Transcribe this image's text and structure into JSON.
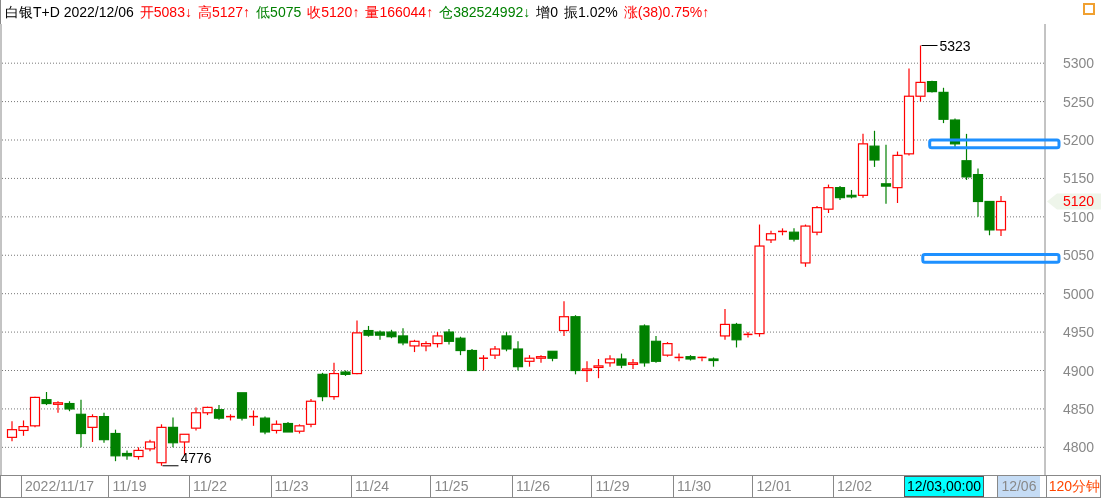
{
  "header": {
    "title": "白银T+D 2022/12/06",
    "quotes": [
      {
        "text": "开5083↓",
        "color": "#ff0000"
      },
      {
        "text": "高5127↑",
        "color": "#ff0000"
      },
      {
        "text": "低5075",
        "color": "#008000"
      },
      {
        "text": "收5120↑",
        "color": "#ff0000"
      },
      {
        "text": "量166044↑",
        "color": "#ff0000"
      },
      {
        "text": "仓382524992↓",
        "color": "#008000"
      },
      {
        "text": "增0",
        "color": "#000000"
      },
      {
        "text": "振1.02%",
        "color": "#000000"
      },
      {
        "text": "涨(38)0.75%↑",
        "color": "#ff0000"
      }
    ]
  },
  "chart_data": {
    "type": "candlestick",
    "ylim": [
      4764,
      5351
    ],
    "yticks": [
      4800,
      4850,
      4900,
      4950,
      5000,
      5050,
      5100,
      5150,
      5200,
      5250,
      5300
    ],
    "grid": true,
    "ohlc": [
      [
        4813,
        4834,
        4808,
        4823
      ],
      [
        4822,
        4835,
        4815,
        4827
      ],
      [
        4828,
        4866,
        4826,
        4865
      ],
      [
        4862,
        4872,
        4855,
        4857
      ],
      [
        4856,
        4860,
        4845,
        4858
      ],
      [
        4857,
        4860,
        4847,
        4850
      ],
      [
        4843,
        4862,
        4800,
        4818
      ],
      [
        4826,
        4843,
        4807,
        4840
      ],
      [
        4840,
        4845,
        4806,
        4810
      ],
      [
        4818,
        4823,
        4782,
        4789
      ],
      [
        4792,
        4796,
        4784,
        4789
      ],
      [
        4788,
        4800,
        4784,
        4796
      ],
      [
        4798,
        4810,
        4795,
        4807
      ],
      [
        4780,
        4830,
        4776,
        4826
      ],
      [
        4826,
        4839,
        4800,
        4806
      ],
      [
        4807,
        4817,
        4790,
        4817
      ],
      [
        4825,
        4852,
        4822,
        4845
      ],
      [
        4845,
        4853,
        4842,
        4852
      ],
      [
        4849,
        4855,
        4836,
        4838
      ],
      [
        4840,
        4843,
        4835,
        4840
      ],
      [
        4871,
        4871,
        4835,
        4838
      ],
      [
        4840,
        4848,
        4828,
        4840
      ],
      [
        4838,
        4840,
        4817,
        4820
      ],
      [
        4822,
        4835,
        4818,
        4830
      ],
      [
        4831,
        4833,
        4820,
        4820
      ],
      [
        4821,
        4830,
        4818,
        4828
      ],
      [
        4830,
        4863,
        4826,
        4860
      ],
      [
        4895,
        4897,
        4860,
        4866
      ],
      [
        4866,
        4910,
        4862,
        4896
      ],
      [
        4898,
        4900,
        4893,
        4895
      ],
      [
        4896,
        4965,
        4895,
        4949
      ],
      [
        4952,
        4958,
        4944,
        4946
      ],
      [
        4950,
        4952,
        4940,
        4946
      ],
      [
        4950,
        4953,
        4942,
        4944
      ],
      [
        4945,
        4955,
        4933,
        4936
      ],
      [
        4932,
        4940,
        4924,
        4938
      ],
      [
        4932,
        4938,
        4925,
        4935
      ],
      [
        4935,
        4950,
        4930,
        4945
      ],
      [
        4950,
        4954,
        4934,
        4938
      ],
      [
        4942,
        4944,
        4920,
        4926
      ],
      [
        4926,
        4928,
        4900,
        4900
      ],
      [
        4915,
        4920,
        4900,
        4916
      ],
      [
        4920,
        4932,
        4915,
        4928
      ],
      [
        4945,
        4950,
        4925,
        4928
      ],
      [
        4928,
        4938,
        4900,
        4905
      ],
      [
        4912,
        4920,
        4905,
        4916
      ],
      [
        4916,
        4920,
        4910,
        4918
      ],
      [
        4925,
        4925,
        4912,
        4916
      ],
      [
        4952,
        4990,
        4945,
        4970
      ],
      [
        4970,
        4972,
        4895,
        4900
      ],
      [
        4900,
        4912,
        4885,
        4902
      ],
      [
        4904,
        4915,
        4890,
        4906
      ],
      [
        4910,
        4920,
        4905,
        4915
      ],
      [
        4915,
        4922,
        4903,
        4907
      ],
      [
        4908,
        4915,
        4902,
        4910
      ],
      [
        4958,
        4960,
        4905,
        4910
      ],
      [
        4938,
        4945,
        4910,
        4912
      ],
      [
        4920,
        4937,
        4918,
        4935
      ],
      [
        4916,
        4922,
        4912,
        4917
      ],
      [
        4918,
        4920,
        4913,
        4915
      ],
      [
        4916,
        4918,
        4912,
        4917
      ],
      [
        4915,
        4917,
        4905,
        4913
      ],
      [
        4945,
        4980,
        4940,
        4960
      ],
      [
        4960,
        4962,
        4930,
        4940
      ],
      [
        4946,
        4950,
        4943,
        4947
      ],
      [
        4948,
        5090,
        4944,
        5062
      ],
      [
        5070,
        5082,
        5066,
        5078
      ],
      [
        5080,
        5085,
        5076,
        5081
      ],
      [
        5080,
        5085,
        5068,
        5071
      ],
      [
        5040,
        5090,
        5035,
        5088
      ],
      [
        5080,
        5114,
        5076,
        5112
      ],
      [
        5110,
        5142,
        5105,
        5138
      ],
      [
        5138,
        5140,
        5122,
        5125
      ],
      [
        5128,
        5135,
        5124,
        5126
      ],
      [
        5128,
        5208,
        5125,
        5195
      ],
      [
        5192,
        5212,
        5165,
        5174
      ],
      [
        5143,
        5194,
        5117,
        5140
      ],
      [
        5138,
        5185,
        5118,
        5180
      ],
      [
        5182,
        5293,
        5180,
        5257
      ],
      [
        5257,
        5323,
        5250,
        5275
      ],
      [
        5276,
        5277,
        5262,
        5263
      ],
      [
        5262,
        5268,
        5222,
        5227
      ],
      [
        5226,
        5228,
        5190,
        5195
      ],
      [
        5173,
        5208,
        5148,
        5152
      ],
      [
        5155,
        5163,
        5100,
        5120
      ],
      [
        5120,
        5120,
        5076,
        5083
      ],
      [
        5083,
        5127,
        5075,
        5120
      ]
    ],
    "annotations": [
      "5323",
      "4776",
      "5120"
    ]
  },
  "date_labels": [
    {
      "text": "2022/11/17",
      "selected": false
    },
    {
      "text": "11/19",
      "selected": false
    },
    {
      "text": "11/22",
      "selected": false
    },
    {
      "text": "11/23",
      "selected": false
    },
    {
      "text": "11/24",
      "selected": false
    },
    {
      "text": "11/25",
      "selected": false
    },
    {
      "text": "11/26",
      "selected": false
    },
    {
      "text": "11/29",
      "selected": false
    },
    {
      "text": "11/30",
      "selected": false
    },
    {
      "text": "12/01",
      "selected": false
    },
    {
      "text": "12/02",
      "selected": false
    },
    {
      "text": "12/06",
      "selected": true
    }
  ],
  "cursor_label": "12/03,00:00",
  "period": "120分钟"
}
